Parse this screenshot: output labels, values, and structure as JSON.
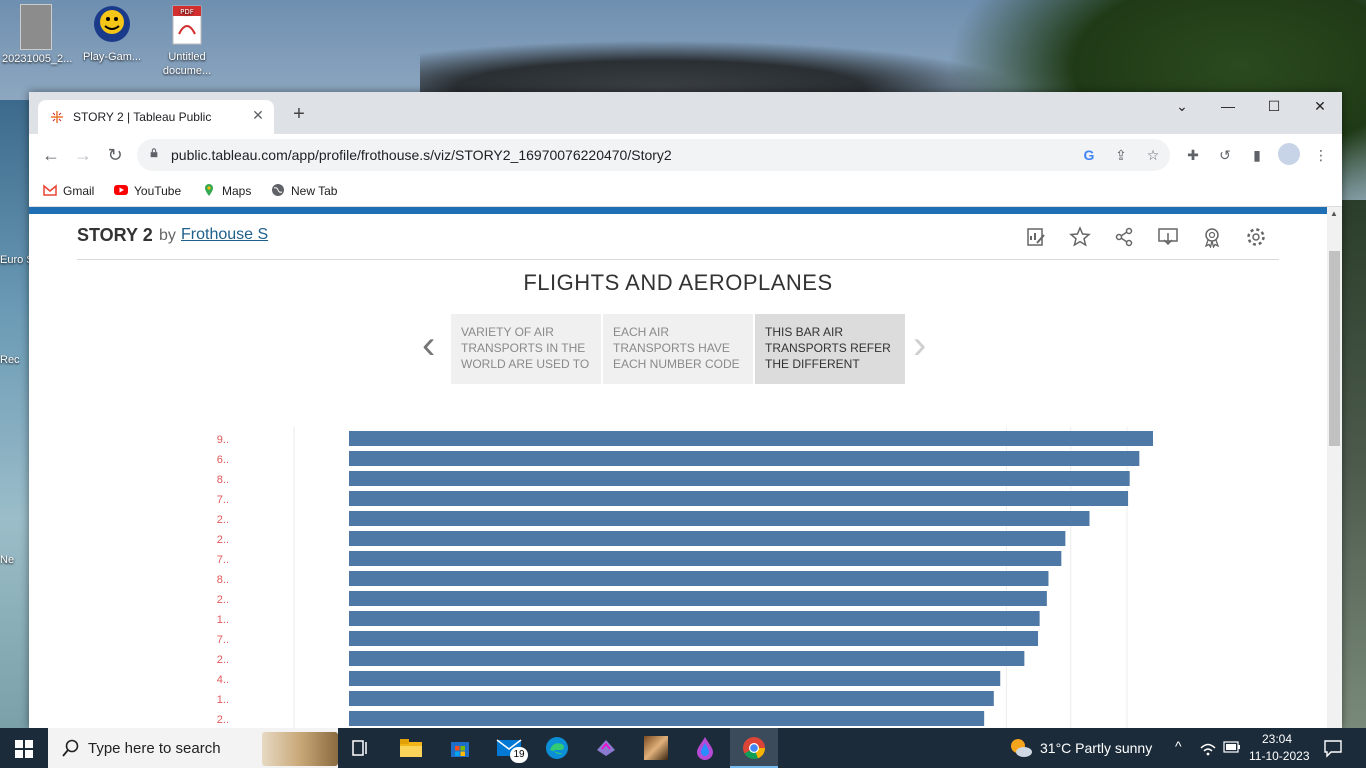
{
  "desktop": {
    "icons": [
      {
        "label": "20231005_2..."
      },
      {
        "label": "Play-Gam..."
      },
      {
        "label": "Untitled docume..."
      }
    ],
    "side_labels": [
      "Euro Sim",
      "Rec",
      "Ne"
    ]
  },
  "browser": {
    "tab_title": "STORY 2 | Tableau Public",
    "url": "public.tableau.com/app/profile/frothouse.s/viz/STORY2_16970076220470/Story2",
    "bookmarks": [
      "Gmail",
      "YouTube",
      "Maps",
      "New Tab"
    ]
  },
  "viz": {
    "title": "STORY 2",
    "by": "by",
    "author": "Frothouse S",
    "story_title": "FLIGHTS AND AEROPLANES",
    "story_points": [
      "VARIETY OF AIR TRANSPORTS IN THE WORLD ARE USED TO",
      "EACH AIR TRANSPORTS HAVE EACH NUMBER CODE",
      "THIS BAR AIR TRANSPORTS REFER THE DIFFERENT"
    ],
    "active_point": 2
  },
  "chart_data": {
    "type": "bar",
    "orientation": "horizontal",
    "categories": [
      "9..",
      "6..",
      "8..",
      "7..",
      "2..",
      "2..",
      "7..",
      "8..",
      "2..",
      "1..",
      "7..",
      "2..",
      "4..",
      "1..",
      "2.."
    ],
    "values": [
      100,
      98.3,
      97.1,
      96.9,
      92.1,
      89.1,
      88.6,
      87.0,
      86.8,
      85.9,
      85.7,
      84.0,
      81.0,
      80.2,
      79.0
    ],
    "bar_color": "#4e79a7",
    "label_color": "#e15759",
    "grid": true
  },
  "taskbar": {
    "search_placeholder": "Type here to search",
    "mail_badge": "19",
    "weather": "31°C  Partly sunny",
    "time": "23:04",
    "date": "11-10-2023"
  }
}
